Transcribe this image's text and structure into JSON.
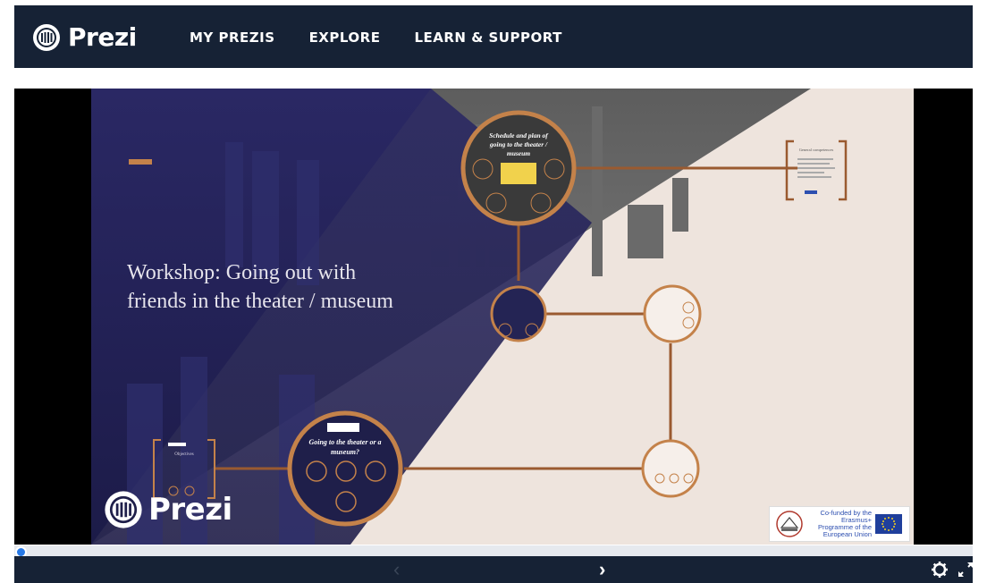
{
  "header": {
    "brand": "Prezi",
    "nav": [
      "MY PREZIS",
      "EXPLORE",
      "LEARN & SUPPORT"
    ]
  },
  "slide": {
    "title": "Workshop: Going out with friends in the theater / museum",
    "node_top": "Schedule and plan of going to the theater / museum",
    "node_bottom": "Going to the theater or a museum?",
    "node_left_title": "Objectives",
    "node_right_title": "General competences",
    "watermark": "Prezi",
    "eu_text": "Co-funded by the Erasmus+ Programme of the European Union"
  },
  "colors": {
    "header_bg": "#162235",
    "accent": "#c4824a",
    "progress": "#2779e6"
  },
  "controls": {
    "prev_icon": "‹",
    "next_icon": "›",
    "progress_fraction": 0.0
  }
}
